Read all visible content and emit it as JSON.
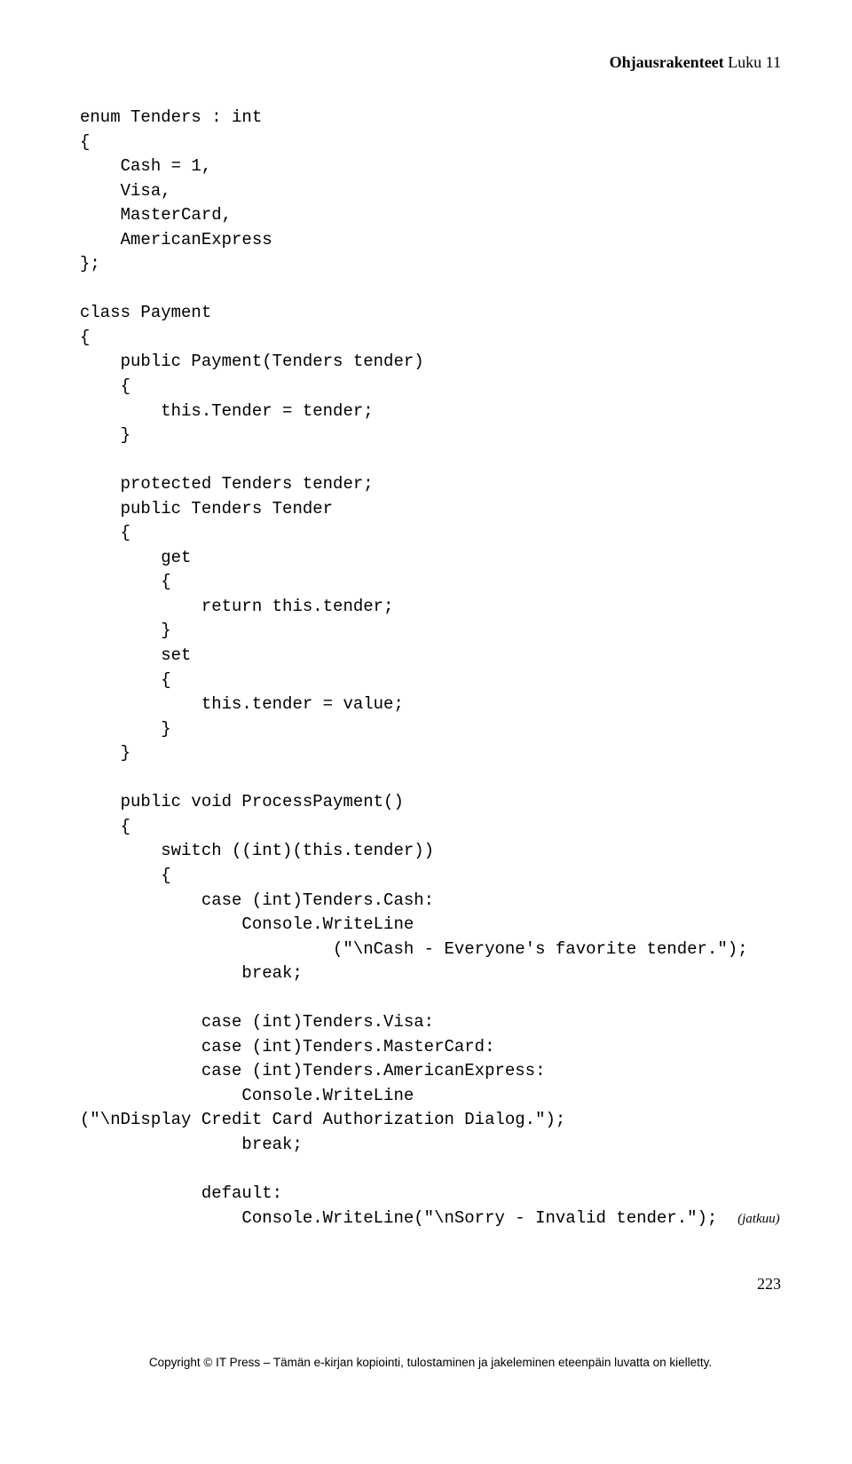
{
  "header": {
    "bold": "Ohjausrakenteet",
    "regular": "  Luku 11"
  },
  "code": {
    "l01": "enum Tenders : int",
    "l02": "{",
    "l03": "    Cash = 1,",
    "l04": "    Visa,",
    "l05": "    MasterCard,",
    "l06": "    AmericanExpress",
    "l07": "};",
    "l08": "",
    "l09": "class Payment",
    "l10": "{",
    "l11": "    public Payment(Tenders tender)",
    "l12": "    {",
    "l13": "        this.Tender = tender;",
    "l14": "    }",
    "l15": "",
    "l16": "    protected Tenders tender;",
    "l17": "    public Tenders Tender",
    "l18": "    {",
    "l19": "        get",
    "l20": "        {",
    "l21": "            return this.tender;",
    "l22": "        }",
    "l23": "        set",
    "l24": "        {",
    "l25": "            this.tender = value;",
    "l26": "        }",
    "l27": "    }",
    "l28": "",
    "l29": "    public void ProcessPayment()",
    "l30": "    {",
    "l31": "        switch ((int)(this.tender))",
    "l32": "        {",
    "l33": "            case (int)Tenders.Cash:",
    "l34": "                Console.WriteLine",
    "l35": "                         (\"\\nCash - Everyone's favorite tender.\");",
    "l36": "                break;",
    "l37": "",
    "l38": "            case (int)Tenders.Visa:",
    "l39": "            case (int)Tenders.MasterCard:",
    "l40": "            case (int)Tenders.AmericanExpress:",
    "l41": "                Console.WriteLine",
    "l42": "(\"\\nDisplay Credit Card Authorization Dialog.\");",
    "l43": "                break;",
    "l44": "",
    "l45": "            default:",
    "l46a": "                Console.WriteLine(\"\\nSorry - Invalid tender.\");",
    "l46b": "(jatkuu)"
  },
  "pagenum": "223",
  "footer": "Copyright © IT Press – Tämän e-kirjan kopiointi, tulostaminen ja jakeleminen eteenpäin luvatta on kielletty."
}
